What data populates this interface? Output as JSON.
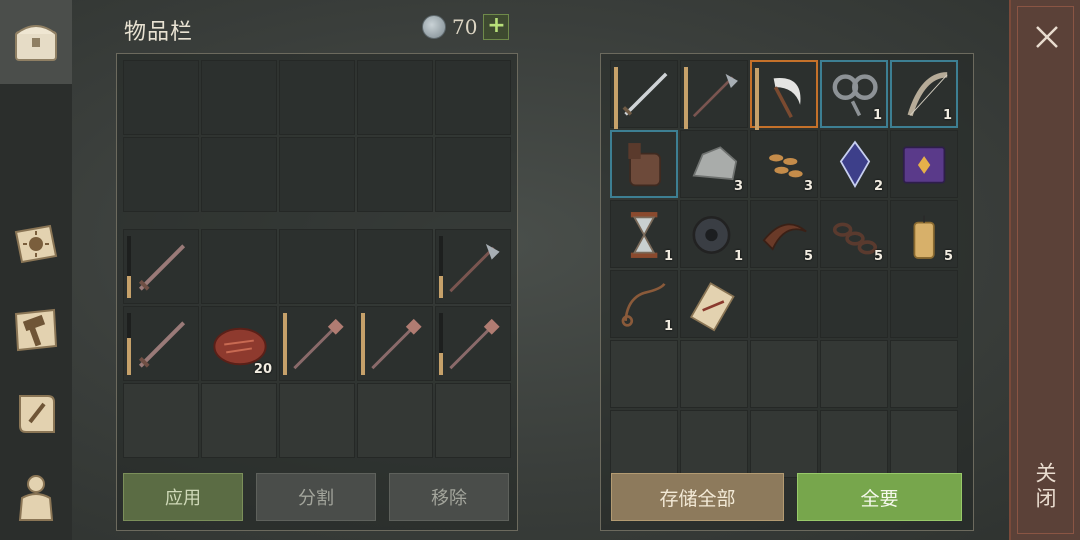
{
  "header": {
    "title": "物品栏",
    "currency_value": "70",
    "plus_label": "+"
  },
  "sidebar": {
    "tabs": [
      {
        "name": "inventory-chest-icon",
        "active": true
      },
      {
        "name": "sun-book-icon",
        "active": false
      },
      {
        "name": "crafting-hammer-map-icon",
        "active": false
      },
      {
        "name": "quest-scroll-icon",
        "active": false
      },
      {
        "name": "character-equipment-icon",
        "active": false
      }
    ]
  },
  "left_panel": {
    "top_grid": [
      {
        "icon": ""
      },
      {
        "icon": ""
      },
      {
        "icon": ""
      },
      {
        "icon": ""
      },
      {
        "icon": ""
      },
      {
        "icon": ""
      },
      {
        "icon": ""
      },
      {
        "icon": ""
      },
      {
        "icon": ""
      },
      {
        "icon": ""
      }
    ],
    "bottom_grid": [
      {
        "icon": "sword-icon",
        "durability": 0.35,
        "qty": ""
      },
      {
        "icon": "",
        "qty": ""
      },
      {
        "icon": "",
        "qty": ""
      },
      {
        "icon": "",
        "qty": ""
      },
      {
        "icon": "halberd-icon",
        "durability": 0.35,
        "qty": ""
      },
      {
        "icon": "sword-icon",
        "durability": 0.6,
        "qty": ""
      },
      {
        "icon": "meat-steak-icon",
        "qty": "20"
      },
      {
        "icon": "mace-spear-icon",
        "durability": 1.0,
        "qty": ""
      },
      {
        "icon": "mace-spear-icon",
        "durability": 1.0,
        "qty": ""
      },
      {
        "icon": "mace-spear-icon",
        "durability": 0.35,
        "qty": ""
      },
      {
        "icon": "",
        "qty": "",
        "faded": true
      },
      {
        "icon": "",
        "qty": "",
        "faded": true
      },
      {
        "icon": "",
        "qty": "",
        "faded": true
      },
      {
        "icon": "",
        "qty": "",
        "faded": true
      },
      {
        "icon": "",
        "qty": "",
        "faded": true
      }
    ],
    "buttons": {
      "apply": "应用",
      "split": "分割",
      "remove": "移除"
    }
  },
  "right_panel": {
    "grid": [
      {
        "icon": "steel-sword-icon",
        "durability": 1.0,
        "qty": ""
      },
      {
        "icon": "halberd-icon",
        "durability": 1.0,
        "qty": ""
      },
      {
        "icon": "sickle-icon",
        "durability": 1.0,
        "qty": "",
        "border": "orange"
      },
      {
        "icon": "shackles-icon",
        "qty": "1",
        "border": "blue"
      },
      {
        "icon": "bone-bow-icon",
        "qty": "1",
        "border": "blue"
      },
      {
        "icon": "gauntlet-icon",
        "qty": "",
        "border": "blue"
      },
      {
        "icon": "stone-ore-icon",
        "qty": "3"
      },
      {
        "icon": "seeds-icon",
        "qty": "3"
      },
      {
        "icon": "crystal-shard-icon",
        "qty": "2"
      },
      {
        "icon": "purple-book-icon",
        "qty": ""
      },
      {
        "icon": "hourglass-icon",
        "qty": "1"
      },
      {
        "icon": "gear-parts-icon",
        "qty": "1"
      },
      {
        "icon": "leather-strap-icon",
        "qty": "5"
      },
      {
        "icon": "chain-icon",
        "qty": "5"
      },
      {
        "icon": "candle-icon",
        "qty": "5"
      },
      {
        "icon": "rope-icon",
        "qty": "1"
      },
      {
        "icon": "paper-scroll-icon",
        "qty": ""
      },
      {
        "icon": "",
        "qty": ""
      },
      {
        "icon": "",
        "qty": ""
      },
      {
        "icon": "",
        "qty": ""
      },
      {
        "icon": "",
        "qty": "",
        "faded": true
      },
      {
        "icon": "",
        "qty": "",
        "faded": true
      },
      {
        "icon": "",
        "qty": "",
        "faded": true
      },
      {
        "icon": "",
        "qty": "",
        "faded": true
      },
      {
        "icon": "",
        "qty": "",
        "faded": true
      },
      {
        "icon": "",
        "qty": "",
        "faded": true
      },
      {
        "icon": "",
        "qty": "",
        "faded": true
      },
      {
        "icon": "",
        "qty": "",
        "faded": true
      },
      {
        "icon": "",
        "qty": "",
        "faded": true
      },
      {
        "icon": "",
        "qty": "",
        "faded": true
      }
    ],
    "buttons": {
      "store_all": "存储全部",
      "take_all": "全要"
    }
  },
  "close": {
    "label": "关闭"
  },
  "colors": {
    "accent_green": "#77a64c",
    "rarity_blue": "#3d7f93",
    "rarity_orange": "#c5712a",
    "durability": "#c6a16a"
  }
}
